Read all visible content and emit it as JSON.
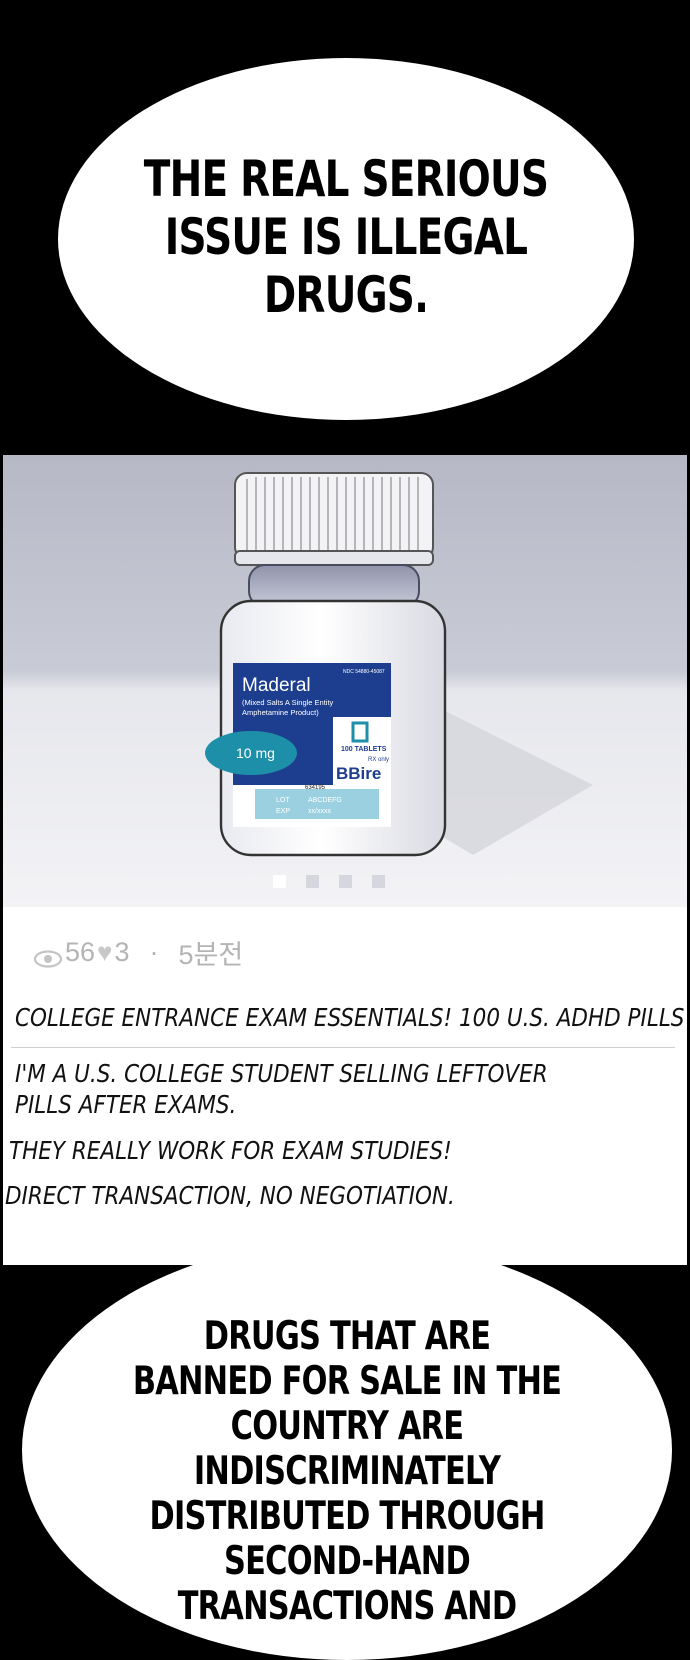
{
  "bubble_top": {
    "text_line1": "THE REAL SERIOUS",
    "text_line2": "ISSUE IS ILLEGAL DRUGS."
  },
  "listing": {
    "bottle_label": {
      "ndc": "NDC 54880-45087",
      "brand": "Maderal",
      "sub1": "(Mixed Salts A Single Entity",
      "sub2": "Amphetamine Product)",
      "dose": "10 mg",
      "count": "100 TABLETS",
      "rx": "RX only",
      "maker": "BBire",
      "code": "634195",
      "lot_label": "LOT",
      "lot_value": "ABCDEFG",
      "exp_label": "EXP",
      "exp_value": "xx/xxxx"
    },
    "views": "56",
    "likes": "3",
    "separator": "·",
    "time": "5분전",
    "title": "COLLEGE ENTRANCE EXAM ESSENTIALS! 100 U.S. ADHD PILLS",
    "desc_line1": "I'M A U.S. COLLEGE STUDENT SELLING LEFTOVER",
    "desc_line2": "PILLS AFTER EXAMS.",
    "desc_line3": "THEY REALLY WORK FOR EXAM STUDIES!",
    "desc_line4": "DIRECT TRANSACTION, NO NEGOTIATION.",
    "carousel_count": 4,
    "carousel_active": 1
  },
  "bubble_bottom": {
    "text_line1": "DRUGS THAT ARE",
    "text_line2": "BANNED FOR SALE IN THE COUNTRY ARE",
    "text_line3": "INDISCRIMINATELY DISTRIBUTED THROUGH",
    "text_line4": "SECOND-HAND TRANSACTIONS AND"
  },
  "colors": {
    "label_blue": "#1d3e8f",
    "teal": "#1e8fa8",
    "background": "#000000"
  }
}
